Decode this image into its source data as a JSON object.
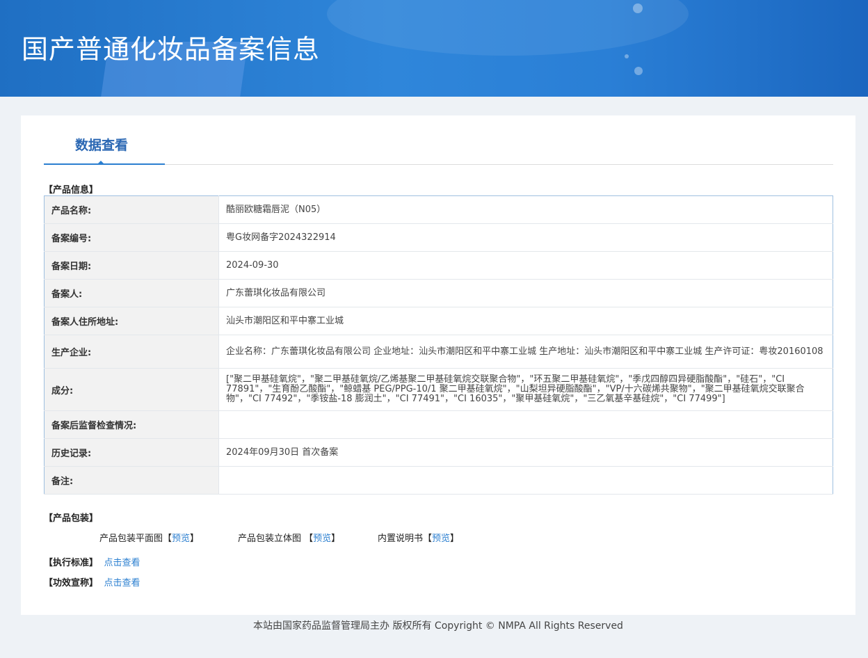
{
  "header": {
    "title": "国产普通化妆品备案信息"
  },
  "tabs": [
    {
      "label": "数据查看",
      "active": true
    }
  ],
  "product_info": {
    "section_label": "【产品信息】",
    "rows": [
      {
        "key": "产品名称:",
        "value": "酷丽欧糖霜唇泥（N05）"
      },
      {
        "key": "备案编号:",
        "value": "粤G妆网备字2024322914"
      },
      {
        "key": "备案日期:",
        "value": "2024-09-30"
      },
      {
        "key": "备案人:",
        "value": "广东蕾琪化妆品有限公司"
      },
      {
        "key": "备案人住所地址:",
        "value": "汕头市潮阳区和平中寨工业城"
      },
      {
        "key": "生产企业:",
        "value": "企业名称：广东蕾琪化妆品有限公司 企业地址：汕头市潮阳区和平中寨工业城 生产地址：汕头市潮阳区和平中寨工业城 生产许可证：粤妆20160108"
      },
      {
        "key": "成分:",
        "value": "[\"聚二甲基硅氧烷\"，\"聚二甲基硅氧烷/乙烯基聚二甲基硅氧烷交联聚合物\"，\"环五聚二甲基硅氧烷\"，\"季戊四醇四异硬脂酸酯\"，\"硅石\"，\"CI 77891\"，\"生育酚乙酸酯\"，\"鲸蜡基 PEG/PPG-10/1 聚二甲基硅氧烷\"，\"山梨坦异硬脂酸酯\"，\"VP/十六碳烯共聚物\"，\"聚二甲基硅氧烷交联聚合物\"，\"CI 77492\"，\"季铵盐-18 膨润土\"，\"CI 77491\"，\"CI 16035\"，\"聚甲基硅氧烷\"，\"三乙氧基辛基硅烷\"，\"CI 77499\"]"
      },
      {
        "key": "备案后监督检查情况:",
        "value": ""
      },
      {
        "key": "历史记录:",
        "value": "2024年09月30日 首次备案"
      },
      {
        "key": "备注:",
        "value": ""
      }
    ]
  },
  "packaging": {
    "section_label": "【产品包装】",
    "items": [
      {
        "label": "产品包装平面图",
        "link": "预览"
      },
      {
        "label": "产品包装立体图 ",
        "link": "预览"
      },
      {
        "label": "内置说明书",
        "link": "预览"
      }
    ]
  },
  "standards": {
    "label": "【执行标准】",
    "link": "点击查看"
  },
  "efficacy": {
    "label": "【功效宣称】",
    "link": "点击查看"
  },
  "footer": {
    "text": "本站由国家药品监督管理局主办 版权所有 Copyright © NMPA All Rights Reserved"
  }
}
